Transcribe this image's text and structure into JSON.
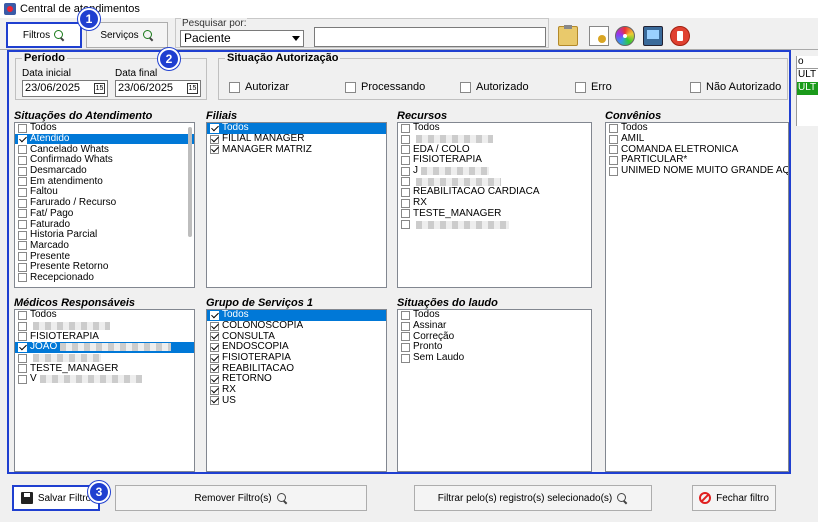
{
  "window": {
    "title": "Central de atendimentos"
  },
  "toolbar": {
    "filtros_label": "Filtros",
    "servicos_label": "Serviços",
    "search_legend": "Pesquisar por:",
    "search_select_value": "Paciente",
    "search_value": ""
  },
  "badges": [
    "1",
    "2",
    "3"
  ],
  "periodo": {
    "title": "Período",
    "start_label": "Data inicial",
    "start_value": "23/06/2025",
    "end_label": "Data final",
    "end_value": "23/06/2025"
  },
  "situacao_autorizacao": {
    "title": "Situação Autorização",
    "options": [
      {
        "label": "Autorizar",
        "checked": false
      },
      {
        "label": "Processando",
        "checked": false
      },
      {
        "label": "Autorizado",
        "checked": false
      },
      {
        "label": "Erro",
        "checked": false
      },
      {
        "label": "Não Autorizado",
        "checked": false
      }
    ]
  },
  "situacoes_atendimento": {
    "title": "Situações do Atendimento",
    "items": [
      {
        "label": "Todos",
        "checked": false
      },
      {
        "label": "Atendido",
        "checked": true,
        "selected": true
      },
      {
        "label": "Cancelado Whats",
        "checked": false
      },
      {
        "label": "Confirmado Whats",
        "checked": false
      },
      {
        "label": "Desmarcado",
        "checked": false
      },
      {
        "label": "Em atendimento",
        "checked": false
      },
      {
        "label": "Faltou",
        "checked": false
      },
      {
        "label": "Farurado / Recurso",
        "checked": false
      },
      {
        "label": "Fat/ Pago",
        "checked": false
      },
      {
        "label": "Faturado",
        "checked": false
      },
      {
        "label": "Historia Parcial",
        "checked": false
      },
      {
        "label": "Marcado",
        "checked": false
      },
      {
        "label": "Presente",
        "checked": false
      },
      {
        "label": "Presente Retorno",
        "checked": false
      },
      {
        "label": "Recepcionado",
        "checked": false
      }
    ]
  },
  "filiais": {
    "title": "Filiais",
    "items": [
      {
        "label": "Todos",
        "checked": true,
        "selected": true
      },
      {
        "label": "FILIAL MANAGER",
        "checked": true
      },
      {
        "label": "MANAGER MATRIZ",
        "checked": true
      }
    ]
  },
  "recursos": {
    "title": "Recursos",
    "items": [
      {
        "label": "Todos",
        "checked": false
      },
      {
        "label": "",
        "checked": false,
        "blurred": true
      },
      {
        "label": "EDA / COLO",
        "checked": false
      },
      {
        "label": "FISIOTERAPIA",
        "checked": false
      },
      {
        "label": "J",
        "checked": false,
        "blurred": true
      },
      {
        "label": "",
        "checked": false,
        "blurred": true
      },
      {
        "label": "REABILITACAO CARDIACA",
        "checked": false
      },
      {
        "label": "RX",
        "checked": false
      },
      {
        "label": "TESTE_MANAGER",
        "checked": false
      },
      {
        "label": "",
        "checked": false,
        "blurred": true
      }
    ]
  },
  "convenios": {
    "title": "Convênios",
    "items": [
      {
        "label": "Todos",
        "checked": false
      },
      {
        "label": "AMIL",
        "checked": false
      },
      {
        "label": "COMANDA ELETRONICA",
        "checked": false
      },
      {
        "label": "PARTICULAR*",
        "checked": false
      },
      {
        "label": "UNIMED NOME MUITO GRANDE AQUI NA",
        "checked": false
      }
    ]
  },
  "medicos": {
    "title": "Médicos Responsáveis",
    "items": [
      {
        "label": "Todos",
        "checked": false
      },
      {
        "label": "",
        "checked": false,
        "blurred": true
      },
      {
        "label": "FISIOTERAPIA",
        "checked": false
      },
      {
        "label": "JOAO",
        "checked": true,
        "selected": true,
        "blurred": true
      },
      {
        "label": "",
        "checked": false,
        "blurred": true
      },
      {
        "label": "TESTE_MANAGER",
        "checked": false
      },
      {
        "label": "V",
        "checked": false,
        "blurred": true
      }
    ]
  },
  "grupo_servicos": {
    "title": "Grupo de Serviços 1",
    "items": [
      {
        "label": "Todos",
        "checked": true,
        "selected": true
      },
      {
        "label": "COLONOSCOPIA",
        "checked": true
      },
      {
        "label": "CONSULTA",
        "checked": true
      },
      {
        "label": "ENDOSCOPIA",
        "checked": true
      },
      {
        "label": "FISIOTERAPIA",
        "checked": true
      },
      {
        "label": "REABILITACAO",
        "checked": true
      },
      {
        "label": "RETORNO",
        "checked": true
      },
      {
        "label": "RX",
        "checked": true
      },
      {
        "label": "US",
        "checked": true
      }
    ]
  },
  "situacoes_laudo": {
    "title": "Situações do laudo",
    "items": [
      {
        "label": "Todos",
        "checked": false
      },
      {
        "label": "Assinar",
        "checked": false
      },
      {
        "label": "Correção",
        "checked": false
      },
      {
        "label": "Pronto",
        "checked": false
      },
      {
        "label": "Sem Laudo",
        "checked": false
      }
    ]
  },
  "right_strip": {
    "r1": "o",
    "r2": "ULT",
    "r3": "ULT"
  },
  "bottom": {
    "salvar": "Salvar Filtro",
    "remover": "Remover Filtro(s)",
    "filtrar": "Filtrar pelo(s) registro(s) selecionado(s)",
    "fechar": "Fechar filtro"
  },
  "colors": {
    "accent": "#1f3fd0",
    "selection": "#0078d7",
    "status_green": "#1a9a1a"
  }
}
